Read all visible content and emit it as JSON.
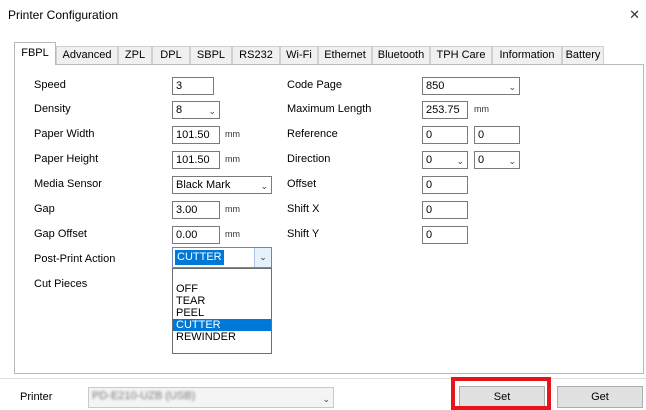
{
  "window": {
    "title": "Printer Configuration",
    "close_glyph": "✕"
  },
  "tabs": [
    "FBPL",
    "Advanced",
    "ZPL",
    "DPL",
    "SBPL",
    "RS232",
    "Wi-Fi",
    "Ethernet",
    "Bluetooth",
    "TPH Care",
    "Information",
    "Battery"
  ],
  "left": {
    "speed": {
      "label": "Speed",
      "value": "3"
    },
    "density": {
      "label": "Density",
      "value": "8"
    },
    "paper_width": {
      "label": "Paper Width",
      "value": "101.50",
      "unit": "mm"
    },
    "paper_height": {
      "label": "Paper Height",
      "value": "101.50",
      "unit": "mm"
    },
    "media_sensor": {
      "label": "Media Sensor",
      "value": "Black Mark"
    },
    "gap": {
      "label": "Gap",
      "value": "3.00",
      "unit": "mm"
    },
    "gap_offset": {
      "label": "Gap Offset",
      "value": "0.00",
      "unit": "mm"
    },
    "post_print_action": {
      "label": "Post-Print Action",
      "value": "CUTTER",
      "options": [
        "OFF",
        "TEAR",
        "PEEL",
        "CUTTER",
        "REWINDER"
      ]
    },
    "cut_pieces": {
      "label": "Cut Pieces"
    }
  },
  "right": {
    "code_page": {
      "label": "Code Page",
      "value": "850"
    },
    "max_length": {
      "label": "Maximum Length",
      "value": "253.75",
      "unit": "mm"
    },
    "reference": {
      "label": "Reference",
      "x": "0",
      "y": "0"
    },
    "direction": {
      "label": "Direction",
      "a": "0",
      "b": "0"
    },
    "offset": {
      "label": "Offset",
      "value": "0"
    },
    "shift_x": {
      "label": "Shift X",
      "value": "0"
    },
    "shift_y": {
      "label": "Shift Y",
      "value": "0"
    }
  },
  "footer": {
    "printer_label": "Printer",
    "printer_value": "PD-E210-UZB (USB)",
    "set_label": "Set",
    "get_label": "Get"
  },
  "colors": {
    "highlight": "#0078d7",
    "annotation_red": "#e8141d"
  },
  "icons": {
    "dropdown": "chevron-down-icon",
    "close": "close-icon"
  }
}
